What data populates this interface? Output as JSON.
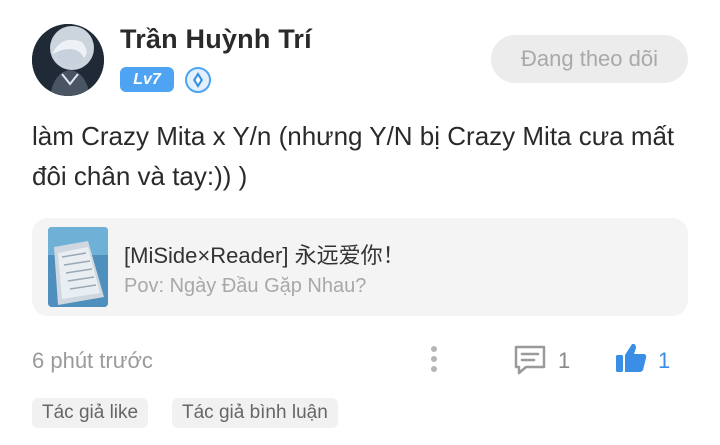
{
  "author": {
    "name": "Trần Huỳnh Trí",
    "level": "Lv7"
  },
  "follow_button": {
    "label": "Đang theo dõi"
  },
  "post": {
    "text": "làm Crazy Mita x Y/n (nhưng Y/N bị Crazy Mita cưa mất đôi chân và tay:)) )"
  },
  "book": {
    "title": "[MiSide×Reader] 永远爱你！",
    "subtitle": "Pov: Ngày Đầu Gặp Nhau?"
  },
  "footer": {
    "time": "6 phút trước",
    "comment_count": "1",
    "like_count": "1"
  },
  "tags": [
    "Tác giả like",
    "Tác giả bình luận"
  ],
  "icons": {
    "more": "more-vertical-icon",
    "comment": "comment-icon",
    "like": "thumbs-up-icon",
    "vip": "vip-badge-icon"
  },
  "colors": {
    "accent": "#3a8ee6",
    "level_badge": "#4fa3f3",
    "follow_bg": "#ececec"
  }
}
